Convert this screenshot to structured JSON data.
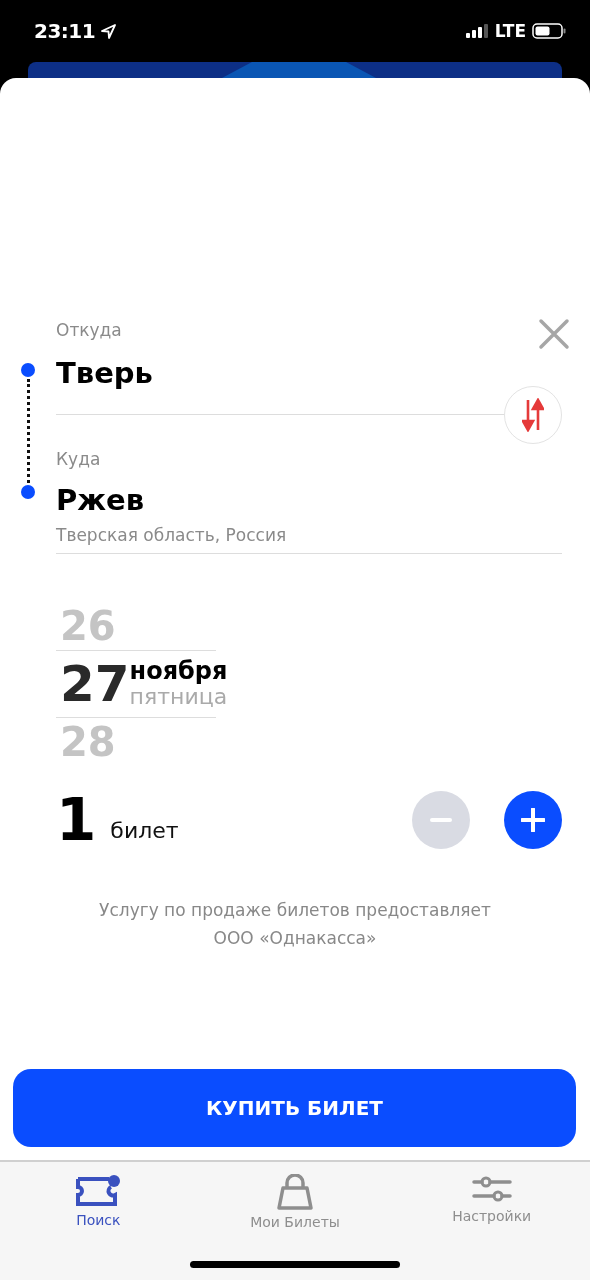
{
  "status_bar": {
    "time": "23:11",
    "network": "LTE"
  },
  "route": {
    "from": {
      "label": "Откуда",
      "value": "Тверь"
    },
    "to": {
      "label": "Куда",
      "value": "Ржев",
      "region": "Тверская область, Россия"
    }
  },
  "dates": [
    {
      "day": "26",
      "selected": false
    },
    {
      "day": "27",
      "selected": true,
      "month": "ноября",
      "weekday": "пятница"
    },
    {
      "day": "28",
      "selected": false
    }
  ],
  "tickets": {
    "count": "1",
    "unit": "билет",
    "decrease_disabled": true
  },
  "disclaimer": "Услугу по продаже билетов предоставляет\nООО «Однакасса»",
  "buy_button": "КУПИТЬ БИЛЕТ",
  "tabs": [
    {
      "label": "Поиск",
      "selected": true,
      "kind": "ticket"
    },
    {
      "label": "Мои Билеты",
      "selected": false,
      "kind": "bag"
    },
    {
      "label": "Настройки",
      "selected": false,
      "kind": "sliders"
    }
  ]
}
